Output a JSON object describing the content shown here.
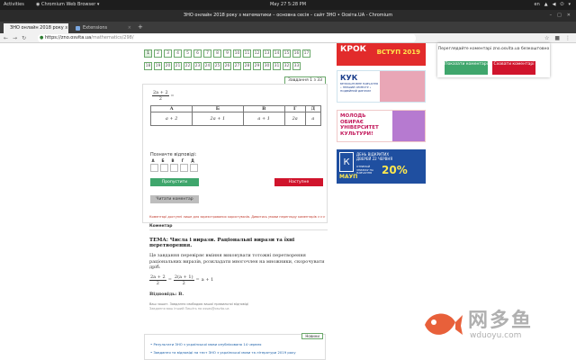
{
  "topbar": {
    "activities": "Activities",
    "app_name": "Chromium Web Browser",
    "clock": "May 27  5:28 PM",
    "lang": "en"
  },
  "window": {
    "title": "ЗНО онлайн 2018 року з математики – основна сесія – сайт ЗНО • Освіта.UA - Chromium"
  },
  "tabs": [
    {
      "label": "ЗНО онлайн 2018 року з м",
      "active": true
    },
    {
      "label": "Extensions",
      "active": false
    }
  ],
  "address": {
    "url_host": "https://zno.osvita.ua",
    "url_path": "/mathematics/298/"
  },
  "pager": {
    "row1": [
      "1",
      "2",
      "3",
      "4",
      "5",
      "6",
      "7",
      "8",
      "9",
      "10",
      "11",
      "12",
      "13",
      "14",
      "15",
      "16",
      "17"
    ],
    "row2": [
      "18",
      "19",
      "20",
      "21",
      "22",
      "23",
      "24",
      "25",
      "26",
      "27",
      "28",
      "29",
      "30",
      "31",
      "32",
      "33"
    ],
    "current": "1"
  },
  "question": {
    "counter": "Завдання 1 з 33",
    "expr_num": "2a + 2",
    "expr_den": "2",
    "expr_tail": "=",
    "option_headers": [
      "А",
      "Б",
      "В",
      "Г",
      "Д"
    ],
    "option_values": [
      "a + 2",
      "2a + 1",
      "a + 1",
      "2a",
      "a"
    ],
    "answer_label": "Позначте відповіді:",
    "answer_letters": [
      "А",
      "Б",
      "В",
      "Г",
      "Д"
    ]
  },
  "buttons": {
    "skip": "Пропустити",
    "next": "Наступне",
    "comment": "Читати коментар"
  },
  "comments": {
    "note": "Коментарі доступні лише для зареєстрованих користувачів. Дивитись умови перегляду коментарів >>>",
    "header": "Коментар"
  },
  "solution": {
    "title": "ТЕМА: Числа і вирази. Раціональні вирази та їхні перетворення.",
    "text": "Це завдання перевіряє вміння виконувати тотожні перетворення раціональних виразів, розкладати многочлен на множники, скорочувати дріб.",
    "eq_num1": "2a + 2",
    "eq_den1": "2",
    "eq_num2": "2(a + 1)",
    "eq_den2": "2",
    "eq_eq1": "=",
    "eq_eq2": "=",
    "eq_tail": "a + 1",
    "answer": "Відповідь: В.",
    "foot1": "Ваш зошит. Завдання свободою вашої правильної відповіді",
    "foot2": "Завдання ваш інший Пишіть на ossas@osvita.ua"
  },
  "news": {
    "header": "Новини",
    "items": [
      "Результати ЗНО з української мови опубліковано 14 червня",
      "Завдання та відповіді на тест ЗНО з української мови та літератури 2019 року"
    ]
  },
  "ads": {
    "ad1_title": "КРОК",
    "ad1_tag": "ВСТУП 2019",
    "ad2_title": "КУК",
    "ad2_lines": "БЕЗКОШТОВНЕ НАВЧАННЯ • ПЕРШИЙ СЕМЕСТР • ПОДВІЙНИЙ ДИПЛОМ",
    "ad3_title": "МОЛОДЬ ОБИРАЄ УНІВЕРСИТЕТ КУЛЬТУРИ!",
    "ad4_logo": "К",
    "ad4_text": "ДЕНЬ ВІДКРИТИХ ДВЕРЕЙ 22 ЧЕРВНЯ",
    "ad4_sub": "ОТРИМАЙ ЗНИЖКУ НА НАВЧАННЯ",
    "ad4_pct": "20%",
    "ad4_brand": "МАУП"
  },
  "popup": {
    "message": "Переглядайте коментарі zno.osvita.ua безкоштовно",
    "show": "Показати коментарі",
    "hide": "Сховати коментарі"
  },
  "watermark": {
    "cn": "网多鱼",
    "url": "wduoyu.com"
  },
  "colors": {
    "accent_green": "#3fa66c",
    "accent_red": "#d0142c"
  }
}
